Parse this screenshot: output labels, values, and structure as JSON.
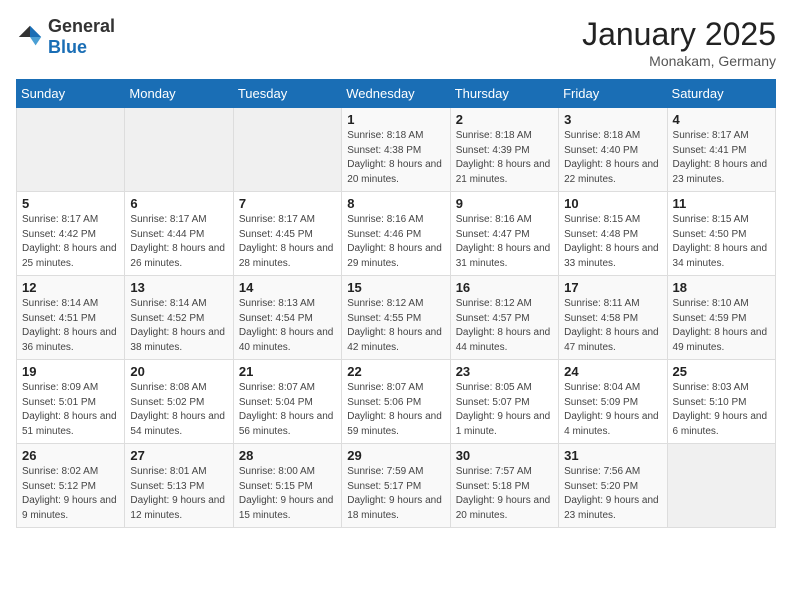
{
  "header": {
    "logo_general": "General",
    "logo_blue": "Blue",
    "title": "January 2025",
    "subtitle": "Monakam, Germany"
  },
  "days_of_week": [
    "Sunday",
    "Monday",
    "Tuesday",
    "Wednesday",
    "Thursday",
    "Friday",
    "Saturday"
  ],
  "weeks": [
    [
      {
        "day": "",
        "sunrise": "",
        "sunset": "",
        "daylight": "",
        "empty": true
      },
      {
        "day": "",
        "sunrise": "",
        "sunset": "",
        "daylight": "",
        "empty": true
      },
      {
        "day": "",
        "sunrise": "",
        "sunset": "",
        "daylight": "",
        "empty": true
      },
      {
        "day": "1",
        "sunrise": "Sunrise: 8:18 AM",
        "sunset": "Sunset: 4:38 PM",
        "daylight": "Daylight: 8 hours and 20 minutes."
      },
      {
        "day": "2",
        "sunrise": "Sunrise: 8:18 AM",
        "sunset": "Sunset: 4:39 PM",
        "daylight": "Daylight: 8 hours and 21 minutes."
      },
      {
        "day": "3",
        "sunrise": "Sunrise: 8:18 AM",
        "sunset": "Sunset: 4:40 PM",
        "daylight": "Daylight: 8 hours and 22 minutes."
      },
      {
        "day": "4",
        "sunrise": "Sunrise: 8:17 AM",
        "sunset": "Sunset: 4:41 PM",
        "daylight": "Daylight: 8 hours and 23 minutes."
      }
    ],
    [
      {
        "day": "5",
        "sunrise": "Sunrise: 8:17 AM",
        "sunset": "Sunset: 4:42 PM",
        "daylight": "Daylight: 8 hours and 25 minutes."
      },
      {
        "day": "6",
        "sunrise": "Sunrise: 8:17 AM",
        "sunset": "Sunset: 4:44 PM",
        "daylight": "Daylight: 8 hours and 26 minutes."
      },
      {
        "day": "7",
        "sunrise": "Sunrise: 8:17 AM",
        "sunset": "Sunset: 4:45 PM",
        "daylight": "Daylight: 8 hours and 28 minutes."
      },
      {
        "day": "8",
        "sunrise": "Sunrise: 8:16 AM",
        "sunset": "Sunset: 4:46 PM",
        "daylight": "Daylight: 8 hours and 29 minutes."
      },
      {
        "day": "9",
        "sunrise": "Sunrise: 8:16 AM",
        "sunset": "Sunset: 4:47 PM",
        "daylight": "Daylight: 8 hours and 31 minutes."
      },
      {
        "day": "10",
        "sunrise": "Sunrise: 8:15 AM",
        "sunset": "Sunset: 4:48 PM",
        "daylight": "Daylight: 8 hours and 33 minutes."
      },
      {
        "day": "11",
        "sunrise": "Sunrise: 8:15 AM",
        "sunset": "Sunset: 4:50 PM",
        "daylight": "Daylight: 8 hours and 34 minutes."
      }
    ],
    [
      {
        "day": "12",
        "sunrise": "Sunrise: 8:14 AM",
        "sunset": "Sunset: 4:51 PM",
        "daylight": "Daylight: 8 hours and 36 minutes."
      },
      {
        "day": "13",
        "sunrise": "Sunrise: 8:14 AM",
        "sunset": "Sunset: 4:52 PM",
        "daylight": "Daylight: 8 hours and 38 minutes."
      },
      {
        "day": "14",
        "sunrise": "Sunrise: 8:13 AM",
        "sunset": "Sunset: 4:54 PM",
        "daylight": "Daylight: 8 hours and 40 minutes."
      },
      {
        "day": "15",
        "sunrise": "Sunrise: 8:12 AM",
        "sunset": "Sunset: 4:55 PM",
        "daylight": "Daylight: 8 hours and 42 minutes."
      },
      {
        "day": "16",
        "sunrise": "Sunrise: 8:12 AM",
        "sunset": "Sunset: 4:57 PM",
        "daylight": "Daylight: 8 hours and 44 minutes."
      },
      {
        "day": "17",
        "sunrise": "Sunrise: 8:11 AM",
        "sunset": "Sunset: 4:58 PM",
        "daylight": "Daylight: 8 hours and 47 minutes."
      },
      {
        "day": "18",
        "sunrise": "Sunrise: 8:10 AM",
        "sunset": "Sunset: 4:59 PM",
        "daylight": "Daylight: 8 hours and 49 minutes."
      }
    ],
    [
      {
        "day": "19",
        "sunrise": "Sunrise: 8:09 AM",
        "sunset": "Sunset: 5:01 PM",
        "daylight": "Daylight: 8 hours and 51 minutes."
      },
      {
        "day": "20",
        "sunrise": "Sunrise: 8:08 AM",
        "sunset": "Sunset: 5:02 PM",
        "daylight": "Daylight: 8 hours and 54 minutes."
      },
      {
        "day": "21",
        "sunrise": "Sunrise: 8:07 AM",
        "sunset": "Sunset: 5:04 PM",
        "daylight": "Daylight: 8 hours and 56 minutes."
      },
      {
        "day": "22",
        "sunrise": "Sunrise: 8:07 AM",
        "sunset": "Sunset: 5:06 PM",
        "daylight": "Daylight: 8 hours and 59 minutes."
      },
      {
        "day": "23",
        "sunrise": "Sunrise: 8:05 AM",
        "sunset": "Sunset: 5:07 PM",
        "daylight": "Daylight: 9 hours and 1 minute."
      },
      {
        "day": "24",
        "sunrise": "Sunrise: 8:04 AM",
        "sunset": "Sunset: 5:09 PM",
        "daylight": "Daylight: 9 hours and 4 minutes."
      },
      {
        "day": "25",
        "sunrise": "Sunrise: 8:03 AM",
        "sunset": "Sunset: 5:10 PM",
        "daylight": "Daylight: 9 hours and 6 minutes."
      }
    ],
    [
      {
        "day": "26",
        "sunrise": "Sunrise: 8:02 AM",
        "sunset": "Sunset: 5:12 PM",
        "daylight": "Daylight: 9 hours and 9 minutes."
      },
      {
        "day": "27",
        "sunrise": "Sunrise: 8:01 AM",
        "sunset": "Sunset: 5:13 PM",
        "daylight": "Daylight: 9 hours and 12 minutes."
      },
      {
        "day": "28",
        "sunrise": "Sunrise: 8:00 AM",
        "sunset": "Sunset: 5:15 PM",
        "daylight": "Daylight: 9 hours and 15 minutes."
      },
      {
        "day": "29",
        "sunrise": "Sunrise: 7:59 AM",
        "sunset": "Sunset: 5:17 PM",
        "daylight": "Daylight: 9 hours and 18 minutes."
      },
      {
        "day": "30",
        "sunrise": "Sunrise: 7:57 AM",
        "sunset": "Sunset: 5:18 PM",
        "daylight": "Daylight: 9 hours and 20 minutes."
      },
      {
        "day": "31",
        "sunrise": "Sunrise: 7:56 AM",
        "sunset": "Sunset: 5:20 PM",
        "daylight": "Daylight: 9 hours and 23 minutes."
      },
      {
        "day": "",
        "sunrise": "",
        "sunset": "",
        "daylight": "",
        "empty": true
      }
    ]
  ]
}
